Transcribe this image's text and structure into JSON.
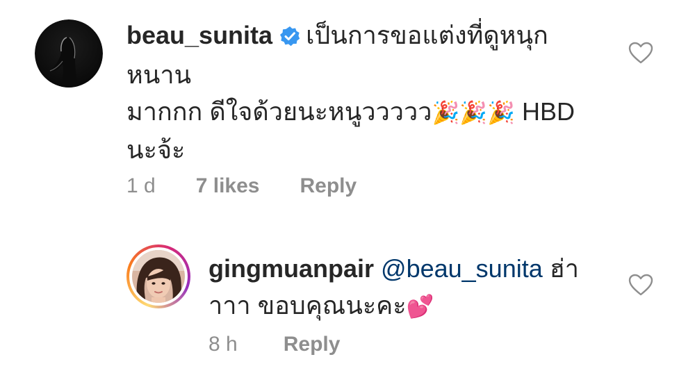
{
  "comments": [
    {
      "username": "beau_sunita",
      "verified": true,
      "text_line1": "เป็นการขอแต่งที่ดูหนุก",
      "text_line2": "หนาน",
      "text_line3": "มากกก ดีใจด้วยนะหนูววววว",
      "text_line3_emoji": "🎉🎉🎉",
      "text_line3_tail": " HBD",
      "text_line4": "นะจ้ะ",
      "time": "1 d",
      "likes": "7 likes",
      "reply_label": "Reply",
      "like_icon": "heart-outline-icon"
    },
    {
      "username": "gingmuanpair",
      "mention": "@beau_sunita",
      "text_after_mention": " ฮ่า",
      "text_line2": "าาา ขอบคุณนะคะ",
      "text_line2_emoji": "💕",
      "time": "8 h",
      "reply_label": "Reply",
      "like_icon": "heart-outline-icon",
      "story_ring_colors": [
        "#feda75",
        "#fa7e1e",
        "#d62976",
        "#962fbf"
      ]
    }
  ]
}
